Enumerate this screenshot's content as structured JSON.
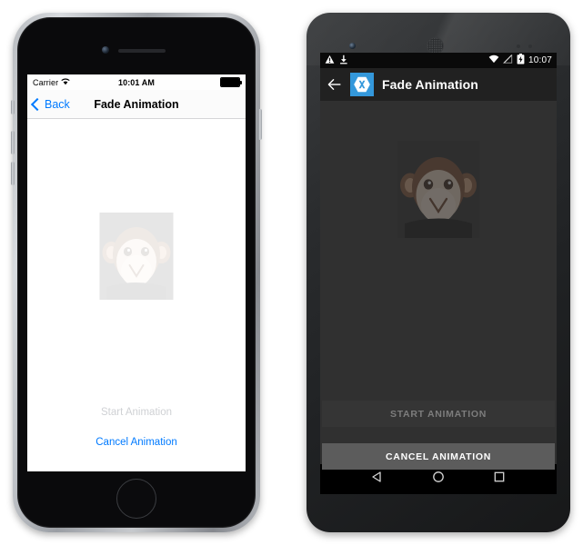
{
  "ios": {
    "status_bar": {
      "carrier": "Carrier",
      "wifi_icon": "wifi-icon",
      "time": "10:01 AM",
      "battery_icon": "battery-full-icon"
    },
    "nav_bar": {
      "back_label": "Back",
      "back_icon": "chevron-left-icon",
      "title": "Fade Animation"
    },
    "content": {
      "image_name": "monkey-image",
      "image_opacity": "0.10"
    },
    "buttons": {
      "start_label": "Start Animation",
      "start_enabled": "false",
      "start_color": "#cfd1d4",
      "cancel_label": "Cancel Animation",
      "cancel_enabled": "true",
      "cancel_color": "#007aff"
    }
  },
  "android": {
    "status_bar": {
      "warning_icon": "warning-triangle-icon",
      "download_icon": "download-icon",
      "wifi_icon": "wifi-icon",
      "signal_icon": "no-signal-icon",
      "battery_icon": "battery-charging-icon",
      "time": "10:07"
    },
    "toolbar": {
      "back_icon": "arrow-left-icon",
      "logo_icon": "xamarin-logo-icon",
      "logo_color": "#3498db",
      "title": "Fade Animation"
    },
    "content": {
      "image_name": "monkey-image",
      "image_opacity": "0.32",
      "background_color": "#303030"
    },
    "buttons": {
      "start_label": "START ANIMATION",
      "start_enabled": "false",
      "start_bg": "#353535",
      "start_color": "#7d7d7d",
      "cancel_label": "CANCEL ANIMATION",
      "cancel_enabled": "true",
      "cancel_bg": "#5c5c5c",
      "cancel_color": "#ffffff"
    },
    "nav_bar": {
      "back_icon": "nav-back-triangle-icon",
      "home_icon": "nav-home-circle-icon",
      "recents_icon": "nav-recents-square-icon"
    }
  }
}
